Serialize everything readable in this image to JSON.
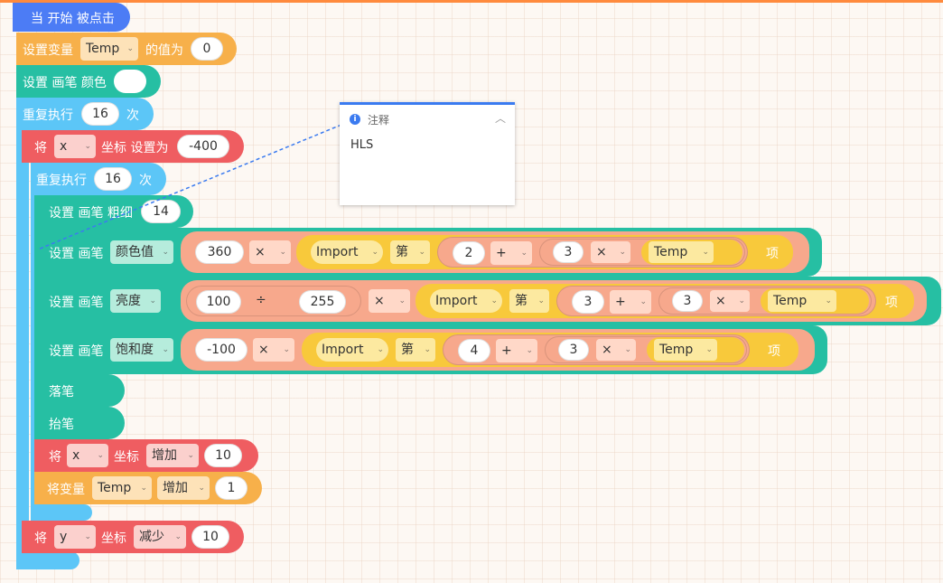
{
  "event": {
    "label": "当 开始 被点击"
  },
  "set_var": {
    "label": "设置变量",
    "var": "Temp",
    "to": "的值为",
    "value": "0"
  },
  "pen_color": {
    "label": "设置 画笔 颜色"
  },
  "repeat_outer": {
    "label": "重复执行",
    "count": "16",
    "suffix": "次"
  },
  "set_x": {
    "label": "将",
    "axis": "x",
    "coord": "坐标 设置为",
    "value": "-400"
  },
  "repeat_inner": {
    "label": "重复执行",
    "count": "16",
    "suffix": "次"
  },
  "pen_size": {
    "label": "设置 画笔 粗细",
    "value": "14"
  },
  "pen_hue": {
    "label": "设置 画笔",
    "prop": "颜色值",
    "a": "360",
    "op1": "×",
    "list": "Import",
    "nth": "第",
    "n1": "2",
    "op2": "+",
    "n2": "3",
    "op3": "×",
    "var": "Temp",
    "item": "项"
  },
  "pen_bright": {
    "label": "设置 画笔",
    "prop": "亮度",
    "a": "100",
    "div": "÷",
    "b": "255",
    "op1": "×",
    "list": "Import",
    "nth": "第",
    "n1": "3",
    "op2": "+",
    "n2": "3",
    "op3": "×",
    "var": "Temp",
    "item": "项"
  },
  "pen_sat": {
    "label": "设置 画笔",
    "prop": "饱和度",
    "a": "-100",
    "op1": "×",
    "list": "Import",
    "nth": "第",
    "n1": "4",
    "op2": "+",
    "n2": "3",
    "op3": "×",
    "var": "Temp",
    "item": "项"
  },
  "pen_down": {
    "label": "落笔"
  },
  "pen_up": {
    "label": "抬笔"
  },
  "change_x": {
    "label": "将",
    "axis": "x",
    "coord": "坐标",
    "op": "增加",
    "value": "10"
  },
  "change_var": {
    "label": "将变量",
    "var": "Temp",
    "op": "增加",
    "value": "1"
  },
  "change_y": {
    "label": "将",
    "axis": "y",
    "coord": "坐标",
    "op": "减少",
    "value": "10"
  },
  "comment": {
    "title": "注释",
    "body": "HLS"
  },
  "colors": {
    "event": "#4c7cf5",
    "variable": "#f7b04a",
    "pen": "#26bfa3",
    "control": "#5cc6f7",
    "motion": "#ef5d61",
    "operator": "#f7a88c",
    "list": "#f8c93b",
    "comment_accent": "#3b7bf0"
  }
}
